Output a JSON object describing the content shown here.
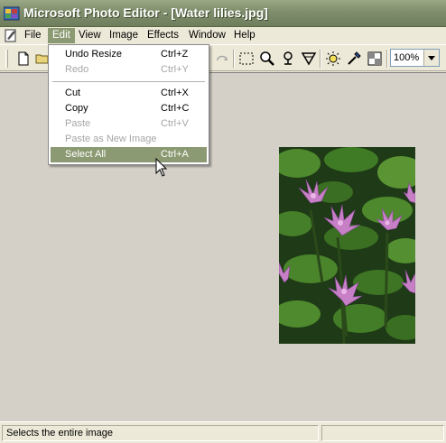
{
  "window": {
    "title": "Microsoft Photo Editor - [Water lilies.jpg]"
  },
  "menubar": {
    "items": [
      {
        "label": "File",
        "name": "menu-file",
        "active": false
      },
      {
        "label": "Edit",
        "name": "menu-edit",
        "active": true
      },
      {
        "label": "View",
        "name": "menu-view",
        "active": false
      },
      {
        "label": "Image",
        "name": "menu-image",
        "active": false
      },
      {
        "label": "Effects",
        "name": "menu-effects",
        "active": false
      },
      {
        "label": "Window",
        "name": "menu-window",
        "active": false
      },
      {
        "label": "Help",
        "name": "menu-help",
        "active": false
      }
    ]
  },
  "edit_menu": {
    "items": [
      {
        "label": "Undo Resize",
        "shortcut": "Ctrl+Z",
        "enabled": true,
        "selected": false
      },
      {
        "label": "Redo",
        "shortcut": "Ctrl+Y",
        "enabled": false,
        "selected": false
      },
      {
        "label": "Cut",
        "shortcut": "Ctrl+X",
        "enabled": true,
        "selected": false
      },
      {
        "label": "Copy",
        "shortcut": "Ctrl+C",
        "enabled": true,
        "selected": false
      },
      {
        "label": "Paste",
        "shortcut": "Ctrl+V",
        "enabled": false,
        "selected": false
      },
      {
        "label": "Paste as New Image",
        "shortcut": "",
        "enabled": false,
        "selected": false
      },
      {
        "label": "Select All",
        "shortcut": "Ctrl+A",
        "enabled": true,
        "selected": true
      }
    ]
  },
  "toolbar": {
    "icons": [
      "new-document-icon",
      "open-folder-icon",
      "redo-icon",
      "select-rectangle-icon",
      "zoom-magnifier-icon",
      "smart-select-icon",
      "crop-icon",
      "brightness-icon",
      "eyedropper-icon",
      "transparency-icon"
    ],
    "zoom_value": "100%"
  },
  "document": {
    "image_subject": "water lilies photo"
  },
  "statusbar": {
    "text": "Selects the entire image"
  },
  "colors": {
    "titlebar": "#7e8d6b",
    "menu_highlight": "#8b9a72",
    "workspace": "#d4d0c8",
    "chrome": "#ECE9D8"
  }
}
